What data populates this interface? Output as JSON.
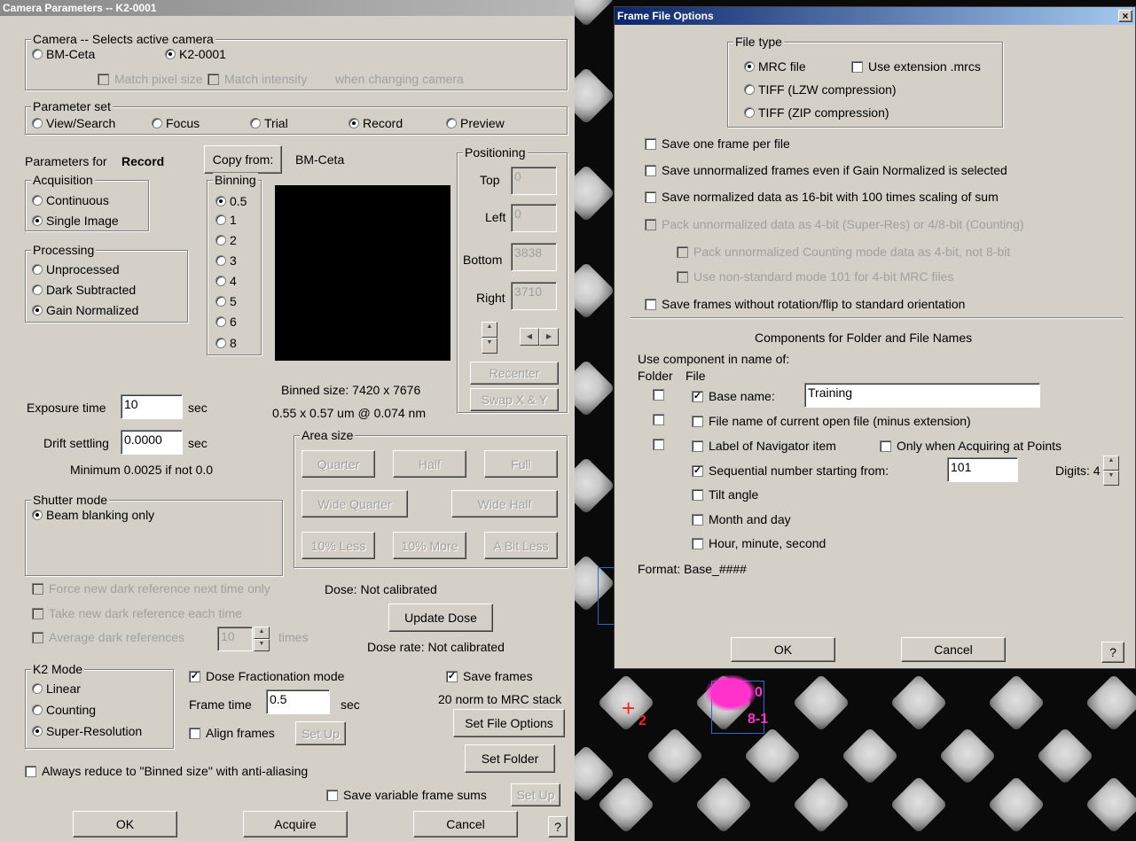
{
  "camera_dialog": {
    "title": "Camera Parameters  --  K2-0001",
    "camera_group": {
      "label": "Camera -- Selects active camera",
      "options": [
        "BM-Ceta",
        "K2-0001"
      ],
      "match_pixel_size": "Match pixel size",
      "match_intensity": "Match intensity",
      "when_changing": "when changing camera"
    },
    "parameter_set": {
      "label": "Parameter set",
      "options": [
        "View/Search",
        "Focus",
        "Trial",
        "Record",
        "Preview"
      ]
    },
    "parameters_for_label": "Parameters for",
    "parameters_for_value": "Record",
    "copy_from_button": "Copy from:",
    "copy_from_camera": "BM-Ceta",
    "acquisition": {
      "label": "Acquisition",
      "options": [
        "Continuous",
        "Single Image"
      ]
    },
    "processing": {
      "label": "Processing",
      "options": [
        "Unprocessed",
        "Dark Subtracted",
        "Gain Normalized"
      ]
    },
    "binning": {
      "label": "Binning",
      "options": [
        "0.5",
        "1",
        "2",
        "3",
        "4",
        "5",
        "6",
        "8"
      ]
    },
    "positioning": {
      "label": "Positioning",
      "top_label": "Top",
      "top": "0",
      "left_label": "Left",
      "left": "0",
      "bottom_label": "Bottom",
      "bottom": "3838",
      "right_label": "Right",
      "right": "3710",
      "recenter": "Recenter",
      "swap": "Swap X & Y"
    },
    "binned_size": "Binned size: 7420 x 7676",
    "pixel_info": "0.55 x 0.57 um @ 0.074 nm",
    "exposure_label": "Exposure time",
    "exposure_value": "10",
    "exposure_unit": "sec",
    "drift_label": "Drift settling",
    "drift_value": "0.0000",
    "drift_unit": "sec",
    "minimum_note": "Minimum 0.0025 if not 0.0",
    "area_size": {
      "label": "Area size",
      "buttons": [
        "Quarter",
        "Half",
        "Full",
        "Wide Quarter",
        "Wide Half",
        "10% Less",
        "10% More",
        "A Bit Less"
      ]
    },
    "shutter": {
      "label": "Shutter mode",
      "option": "Beam blanking only"
    },
    "force_dark": "Force new dark reference next time only",
    "take_dark": "Take new dark reference each time",
    "average_dark": "Average dark references",
    "average_value": "10",
    "average_unit": "times",
    "dose": "Dose: Not calibrated",
    "update_dose": "Update Dose",
    "dose_rate": "Dose rate: Not calibrated",
    "k2_mode": {
      "label": "K2 Mode",
      "options": [
        "Linear",
        "Counting",
        "Super-Resolution"
      ]
    },
    "dose_fractionation": "Dose Fractionation mode",
    "frame_time_label": "Frame time",
    "frame_time_value": "0.5",
    "frame_time_unit": "sec",
    "align_frames": "Align frames",
    "set_up": "Set Up",
    "save_frames": "Save frames",
    "save_frames_note": "20 norm to MRC stack",
    "set_file_options": "Set File Options",
    "set_folder": "Set Folder",
    "always_reduce": "Always reduce to \"Binned size\" with anti-aliasing",
    "save_variable": "Save variable frame sums",
    "set_up2": "Set Up",
    "ok": "OK",
    "acquire": "Acquire",
    "cancel": "Cancel",
    "help": "?"
  },
  "frame_dialog": {
    "title": "Frame File Options",
    "close": "×",
    "file_type": {
      "label": "File type",
      "mrc": "MRC file",
      "use_ext": "Use extension .mrcs",
      "tiff_lzw": "TIFF (LZW compression)",
      "tiff_zip": "TIFF (ZIP compression)"
    },
    "options": [
      "Save one frame per file",
      "Save unnormalized frames even if Gain Normalized is selected",
      "Save normalized data as 16-bit with 100 times scaling of sum"
    ],
    "pack_unnormalized": "Pack unnormalized data as 4-bit (Super-Res) or 4/8-bit (Counting)",
    "pack_counting": "Pack unnormalized Counting mode data as 4-bit, not 8-bit",
    "non_standard": "Use non-standard mode 101 for 4-bit MRC files",
    "without_rotation": "Save frames without rotation/flip to standard orientation",
    "components_title": "Components for Folder and File Names",
    "use_component": "Use component in name of:",
    "folder": "Folder",
    "file": "File",
    "base_name_label": "Base name:",
    "base_name_value": "Training",
    "file_name_current": "File name of current open file (minus extension)",
    "label_navigator": "Label of Navigator item",
    "only_when": "Only when Acquiring at Points",
    "sequential": "Sequential number starting from:",
    "seq_value": "101",
    "digits": "Digits: 4",
    "tilt": "Tilt angle",
    "month": "Month and day",
    "hour": "Hour, minute, second",
    "format": "Format: Base_####",
    "ok": "OK",
    "cancel": "Cancel",
    "help": "?"
  },
  "overlay": {
    "marker_label": "2",
    "nav_label1": "0",
    "nav_label2": "8-1"
  }
}
